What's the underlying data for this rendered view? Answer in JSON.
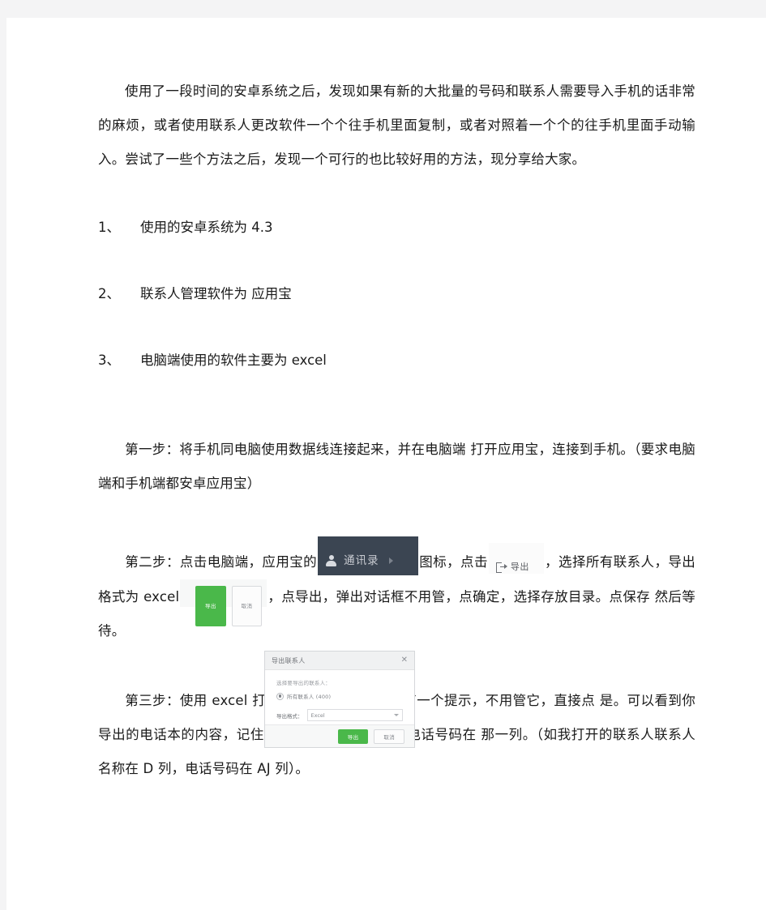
{
  "document": {
    "paragraphs": {
      "intro": "使用了一段时间的安卓系统之后，发现如果有新的大批量的号码和联系人需要导入手机的话非常的麻烦，或者使用联系人更改软件一个个往手机里面复制，或者对照着一个个的往手机里面手动输入。尝试了一些个方法之后，发现一个可行的也比较好用的方法，现分享给大家。",
      "step1": "第一步：将手机同电脑使用数据线连接起来，并在电脑端 打开应用宝，连接到手机。（要求电脑端和手机端都安卓应用宝）",
      "step2_a": "第二步：点击电脑端，应用宝的",
      "step2_b": "图标，点击",
      "step2_c": "，选择所有联系人，导出格式为 excel",
      "step2_d": "，点导出，弹出对话框不用管，点确定，选择存放目录。点保存 然后等待。",
      "step3": "第三步：使用 excel 打开刚才导出的文件，会有一个提示，不用管它，直接点 是。可以看到你导出的电话本的内容，记住联系人名称在 那一列，电话号码在 那一列。（如我打开的联系人联系人名称在 D 列，电话号码在 AJ 列）。"
    },
    "numbered_list": [
      {
        "num": "1、",
        "text": "使用的安卓系统为 4.3"
      },
      {
        "num": "2、",
        "text": "联系人管理软件为 应用宝"
      },
      {
        "num": "3、",
        "text": "电脑端使用的软件主要为 excel"
      }
    ]
  },
  "embedded_contacts_nav": {
    "label": "通讯录",
    "icon": "person-icon",
    "arrow": "triangle-right-icon",
    "bg_color": "#3b4552",
    "text_color": "#c9ccd2"
  },
  "embedded_export_button": {
    "label": "导出",
    "icon": "export-icon",
    "bg_color": "#fbfbfb",
    "text_color": "#5a5d62"
  },
  "embedded_dialog": {
    "title": "导出联系人",
    "close_icon": "close-icon",
    "prompt": "选择要导出的联系人：",
    "radio_option": "所有联系人 (400)",
    "format_label": "导出格式：",
    "format_value": "Excel",
    "format_caret": "chevron-down-icon",
    "confirm_label": "导出",
    "cancel_label": "取消",
    "confirm_color": "#4ab84a",
    "title_bar_color": "#f0f1f2",
    "footer_color": "#f7f8f8"
  }
}
